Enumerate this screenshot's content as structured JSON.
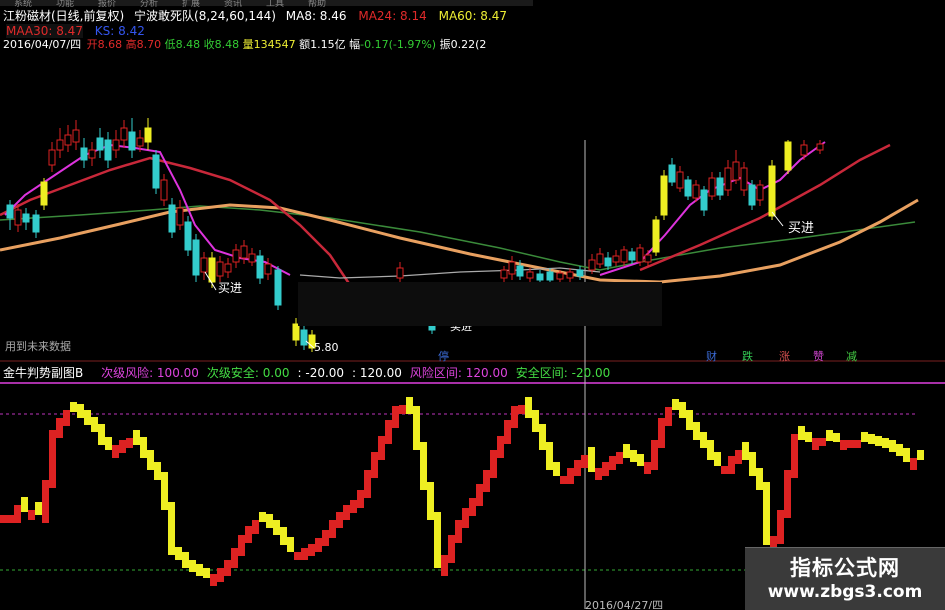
{
  "menu": {
    "items": [
      "系统",
      "功能",
      "报价",
      "分析",
      "扩展",
      "资讯",
      "工具",
      "帮助"
    ]
  },
  "header": {
    "stock_title": "江粉磁材(日线,前复权)",
    "indicator_name": "宁波敢死队",
    "indicator_params": "(8,24,60,144)",
    "ma8_label": "MA8: 8.46",
    "ma24_label": "MA24: 8.14",
    "ma60_label": "MA60: 8.47",
    "maa30_label": "MAA30: 8.47",
    "ks_label": "KS: 8.42",
    "date": "2016/04/07/四",
    "open_label": "开",
    "open_value": "8.68",
    "high_label": "高",
    "high_value": "8.70",
    "low_label": "低",
    "low_value": "8.48",
    "close_label": "收",
    "close_value": "8.48",
    "volume_label": "量",
    "volume_value": "134547",
    "amount_label": "额",
    "amount_value": "1.15亿",
    "change_label": "幅",
    "change_value": "-0.17(-1.97%)",
    "amplitude_label": "振",
    "amplitude_value": "0.22(2"
  },
  "main_chart": {
    "annotations": {
      "buy_1": "买进",
      "buy_2": "买进",
      "buy_3": "买进",
      "low_price": "5.80"
    },
    "future_data_text": "用到未来数据",
    "signal_labels": [
      {
        "text": "停",
        "color": "#3a6ad4"
      },
      {
        "text": "财",
        "color": "#3a6ad4"
      },
      {
        "text": "跌",
        "color": "#33cc55"
      },
      {
        "text": "涨",
        "color": "#d85050"
      },
      {
        "text": "赞",
        "color": "#cc44cc"
      },
      {
        "text": "减",
        "color": "#44cc44"
      }
    ],
    "colors": {
      "ma_magenta": "#dd33dd",
      "ma_red": "#c8283a",
      "ma_orange": "#e8a060",
      "ma_green": "#3a8a3a",
      "up": "#dd2222",
      "down": "#33cccc",
      "highlight": "#eeee22"
    }
  },
  "sub_chart": {
    "title": "金牛判势副图B",
    "items": [
      {
        "label": "次级风险:",
        "value": "100.00",
        "color": "#dd44dd"
      },
      {
        "label": "次级安全:",
        "value": "0.00",
        "color": "#44dd44"
      },
      {
        "label": ":",
        "value": "-20.00",
        "color": "#ffffff"
      },
      {
        "label": ":",
        "value": "120.00",
        "color": "#ffffff"
      },
      {
        "label": "风险区间:",
        "value": "120.00",
        "color": "#dd44dd"
      },
      {
        "label": "安全区间:",
        "value": "-20.00",
        "color": "#44dd44"
      }
    ]
  },
  "footer": {
    "date_fragment": "2016/04/27/四"
  },
  "watermark": {
    "title": "指标公式网",
    "url": "www.zbgs3.com"
  }
}
